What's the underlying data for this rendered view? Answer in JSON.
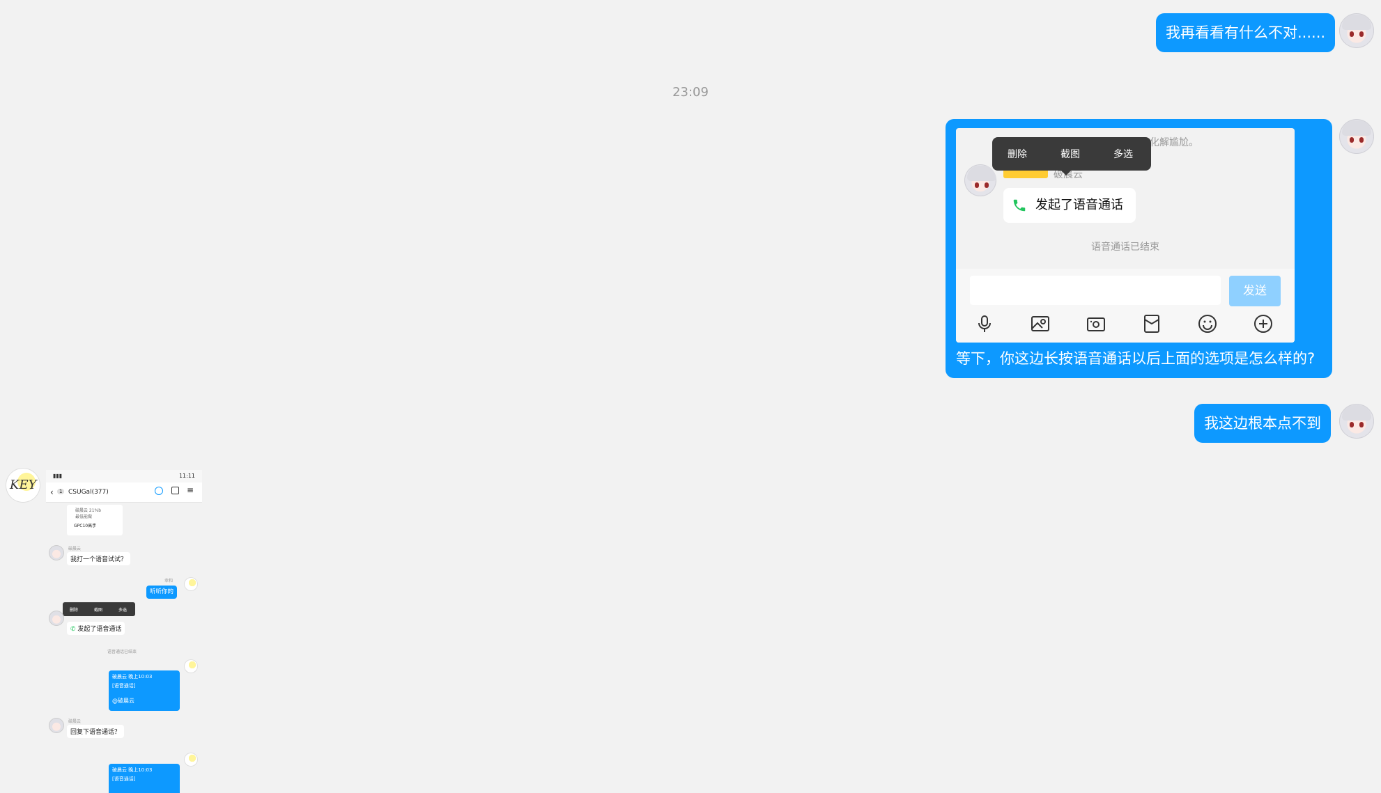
{
  "messages": {
    "m1": "我再看看有什么不对......",
    "timestamp": "23:09",
    "m2_caption": "等下，你这边长按语音通话以后上面的选项是怎么样的?",
    "m3": "我这边根本点不到"
  },
  "embedded_screenshot": {
    "top_faint": "化解尴尬。",
    "context_menu": [
      "删除",
      "截图",
      "多选"
    ],
    "sender_fragment": "破晨云",
    "call_text": "发起了语音通话",
    "call_ended": "语音通话已结束",
    "send_button": "发送",
    "toolbar_icons": [
      "mic-icon",
      "image-icon",
      "camera-icon",
      "red-packet-icon",
      "emoji-icon",
      "plus-icon"
    ]
  },
  "phone_screenshot": {
    "status_time": "11:11",
    "group_name": "CSUGal(377)",
    "back_badge": "1",
    "card_line1": "破晨云 21%b",
    "card_line2": "最低能做",
    "card_line3": "GPC10高手",
    "sender1": "破晨云",
    "msg1": "我打一个语音试试？",
    "me_meta1": "幸和",
    "me_msg1": "听听你的",
    "context_menu": [
      "删除",
      "截图",
      "多选"
    ],
    "call_text": "发起了语音通话",
    "call_ended": "语音通话已结束",
    "reply_header": "破晨云 晚上10:03",
    "reply_body": "[语音通话]",
    "reply_mention": "@破晨云",
    "sender2": "破晨云",
    "msg2": "回复下语音通话？",
    "reply_header2": "破晨云 晚上10:03",
    "reply_body2": "[语音通话]",
    "key_logo_text": "KEY"
  }
}
